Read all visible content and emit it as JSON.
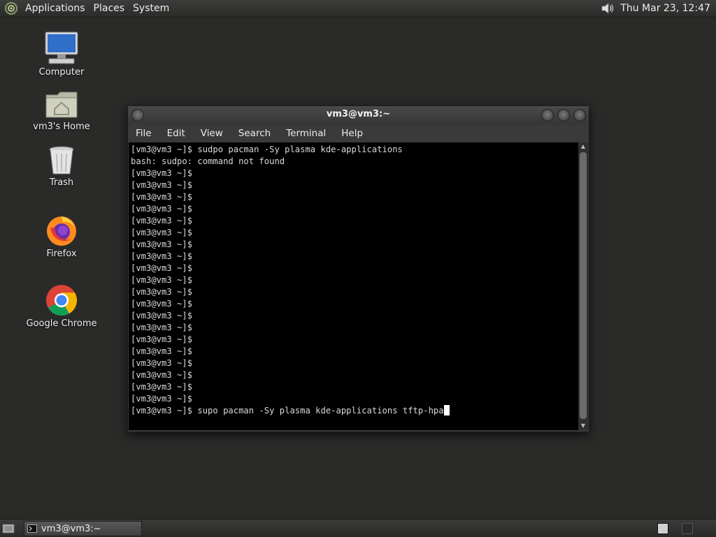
{
  "top_panel": {
    "menus": [
      "Applications",
      "Places",
      "System"
    ],
    "clock": "Thu Mar 23, 12:47",
    "volume_icon": "speaker-icon"
  },
  "desktop": {
    "icons": [
      {
        "label": "Computer",
        "icon": "computer-icon"
      },
      {
        "label": "vm3's Home",
        "icon": "home-folder-icon"
      },
      {
        "label": "Trash",
        "icon": "trash-icon"
      },
      {
        "label": "Firefox",
        "icon": "firefox-icon"
      },
      {
        "label": "Google Chrome",
        "icon": "chrome-icon"
      }
    ]
  },
  "terminal": {
    "title": "vm3@vm3:~",
    "menu": [
      "File",
      "Edit",
      "View",
      "Search",
      "Terminal",
      "Help"
    ],
    "lines": [
      "[vm3@vm3 ~]$ sudpo pacman -Sy plasma kde-applications",
      "bash: sudpo: command not found",
      "[vm3@vm3 ~]$",
      "[vm3@vm3 ~]$",
      "[vm3@vm3 ~]$",
      "[vm3@vm3 ~]$",
      "[vm3@vm3 ~]$",
      "[vm3@vm3 ~]$",
      "[vm3@vm3 ~]$",
      "[vm3@vm3 ~]$",
      "[vm3@vm3 ~]$",
      "[vm3@vm3 ~]$",
      "[vm3@vm3 ~]$",
      "[vm3@vm3 ~]$",
      "[vm3@vm3 ~]$",
      "[vm3@vm3 ~]$",
      "[vm3@vm3 ~]$",
      "[vm3@vm3 ~]$",
      "[vm3@vm3 ~]$",
      "[vm3@vm3 ~]$",
      "[vm3@vm3 ~]$",
      "[vm3@vm3 ~]$",
      "[vm3@vm3 ~]$ supo pacman -Sy plasma kde-applications tftp-hpa"
    ]
  },
  "bottom_panel": {
    "task_label": "vm3@vm3:~"
  },
  "colors": {
    "desktop_bg": "#2a2b29",
    "terminal_bg": "#000000",
    "terminal_text": "#d9d9d9"
  }
}
